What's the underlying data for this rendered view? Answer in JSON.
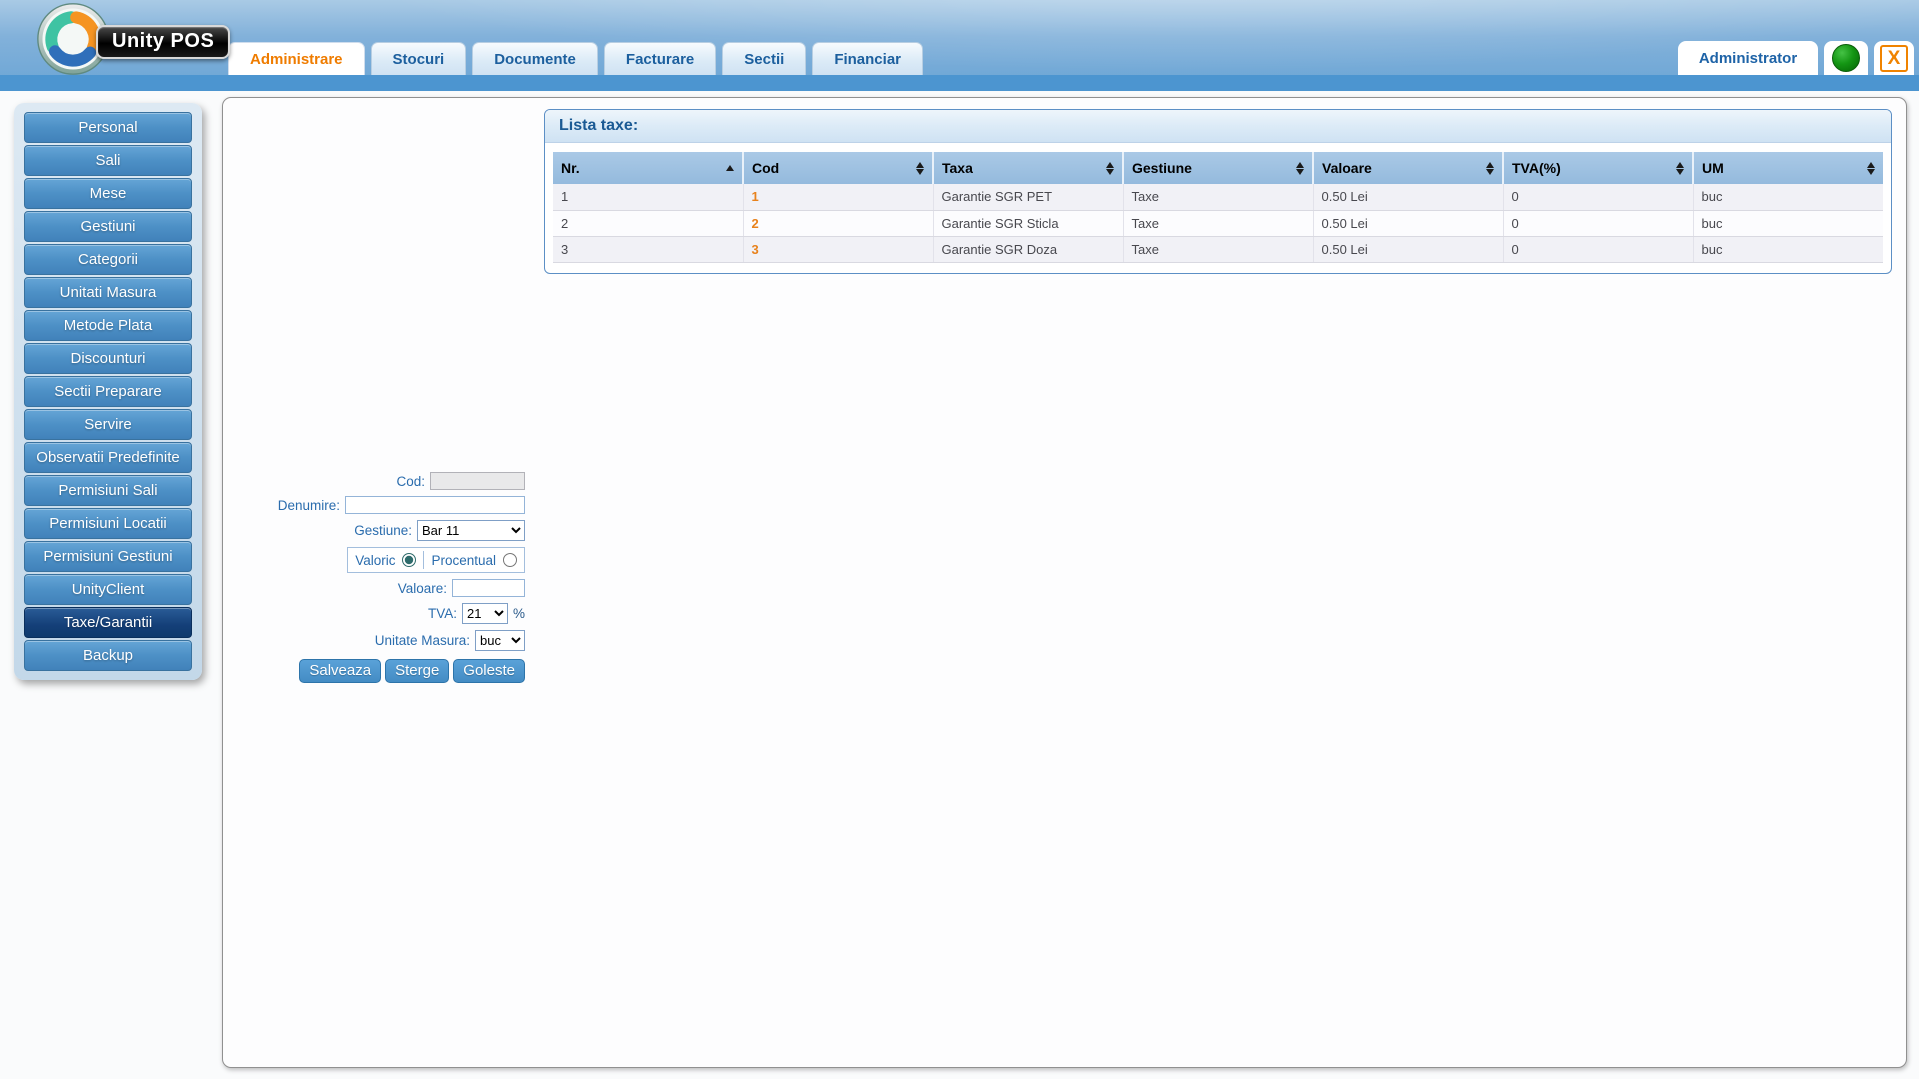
{
  "app": {
    "logo_text": "Unity POS"
  },
  "header": {
    "tabs": [
      {
        "label": "Administrare",
        "active": true
      },
      {
        "label": "Stocuri",
        "active": false
      },
      {
        "label": "Documente",
        "active": false
      },
      {
        "label": "Facturare",
        "active": false
      },
      {
        "label": "Sectii",
        "active": false
      },
      {
        "label": "Financiar",
        "active": false
      }
    ],
    "user_tab_label": "Administrator",
    "close_label": "X"
  },
  "sidebar": {
    "items": [
      {
        "label": "Personal",
        "active": false
      },
      {
        "label": "Sali",
        "active": false
      },
      {
        "label": "Mese",
        "active": false
      },
      {
        "label": "Gestiuni",
        "active": false
      },
      {
        "label": "Categorii",
        "active": false
      },
      {
        "label": "Unitati Masura",
        "active": false
      },
      {
        "label": "Metode Plata",
        "active": false
      },
      {
        "label": "Discounturi",
        "active": false
      },
      {
        "label": "Sectii Preparare",
        "active": false
      },
      {
        "label": "Servire",
        "active": false
      },
      {
        "label": "Observatii Predefinite",
        "active": false
      },
      {
        "label": "Permisiuni Sali",
        "active": false
      },
      {
        "label": "Permisiuni Locatii",
        "active": false
      },
      {
        "label": "Permisiuni Gestiuni",
        "active": false
      },
      {
        "label": "UnityClient",
        "active": false
      },
      {
        "label": "Taxe/Garantii",
        "active": true
      },
      {
        "label": "Backup",
        "active": false
      }
    ]
  },
  "list_panel": {
    "title": "Lista taxe:",
    "columns": [
      {
        "label": "Nr.",
        "sort": "asc"
      },
      {
        "label": "Cod",
        "sort": "both"
      },
      {
        "label": "Taxa",
        "sort": "both"
      },
      {
        "label": "Gestiune",
        "sort": "both"
      },
      {
        "label": "Valoare",
        "sort": "both"
      },
      {
        "label": "TVA(%)",
        "sort": "both"
      },
      {
        "label": "UM",
        "sort": "both"
      }
    ],
    "rows": [
      {
        "nr": "1",
        "cod": "1",
        "taxa": "Garantie SGR PET",
        "gestiune": "Taxe",
        "valoare": "0.50 Lei",
        "tva": "0",
        "um": "buc"
      },
      {
        "nr": "2",
        "cod": "2",
        "taxa": "Garantie SGR Sticla",
        "gestiune": "Taxe",
        "valoare": "0.50 Lei",
        "tva": "0",
        "um": "buc"
      },
      {
        "nr": "3",
        "cod": "3",
        "taxa": "Garantie SGR Doza",
        "gestiune": "Taxe",
        "valoare": "0.50 Lei",
        "tva": "0",
        "um": "buc"
      }
    ]
  },
  "form": {
    "cod": {
      "label": "Cod:",
      "value": ""
    },
    "denumire": {
      "label": "Denumire:",
      "value": ""
    },
    "gestiune": {
      "label": "Gestiune:",
      "selected": "Bar 11"
    },
    "tip": {
      "valoric_label": "Valoric",
      "procentual_label": "Procentual",
      "selected": "valoric"
    },
    "valoare": {
      "label": "Valoare:",
      "value": ""
    },
    "tva": {
      "label": "TVA:",
      "selected": "21",
      "suffix": "%"
    },
    "um": {
      "label": "Unitate Masura:",
      "selected": "buc"
    },
    "buttons": {
      "save": "Salveaza",
      "delete": "Sterge",
      "clear": "Goleste"
    }
  },
  "colors": {
    "active_tab_text": "#ef7c00",
    "tab_text": "#1c5f9e",
    "header_strip": "#4c95d0",
    "sidebar_button_active": "#123f79",
    "table_header_bg": "#9dc0e2",
    "cod_value_text": "#e8821c",
    "form_button_bg": "#4e9ad3"
  }
}
